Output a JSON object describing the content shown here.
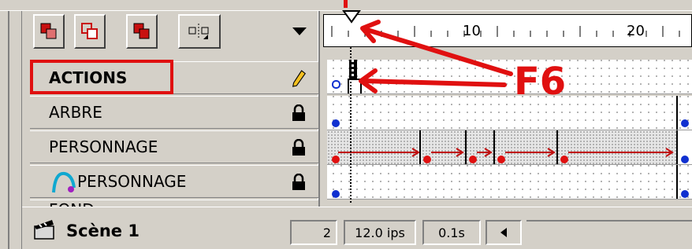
{
  "toolbar": {
    "buttons": [
      {
        "icon": "onion-skin-icon"
      },
      {
        "icon": "onion-skin-outlines-icon"
      },
      {
        "icon": "edit-multiple-frames-icon"
      },
      {
        "icon": "modify-onion-markers-icon"
      }
    ],
    "menu_icon": "menu-dropdown-icon"
  },
  "ruler": {
    "labels": [
      "10",
      "20"
    ]
  },
  "layers": [
    {
      "name": "ACTIONS",
      "selected": true,
      "status_icon": "pencil-icon"
    },
    {
      "name": "ARBRE",
      "selected": false,
      "status_icon": "lock-icon"
    },
    {
      "name": "PERSONNAGE",
      "selected": false,
      "status_icon": "lock-icon"
    },
    {
      "name": "PERSONNAGE",
      "selected": false,
      "status_icon": "lock-icon",
      "type_icon": "motion-guide-icon"
    },
    {
      "name": "FOND",
      "selected": false,
      "status_icon": "lock-icon"
    }
  ],
  "annotation": {
    "label": "F6",
    "color": "#e01010"
  },
  "status_bar": {
    "scene_label": "Scène 1",
    "current_frame": "2",
    "frame_rate": "12.0 ips",
    "elapsed_time": "0.1s"
  },
  "colors": {
    "keyframe": "#1030d0",
    "keyframe_red": "#e01010",
    "tween_arrow": "#c01010",
    "selection_box": "#e01010"
  }
}
